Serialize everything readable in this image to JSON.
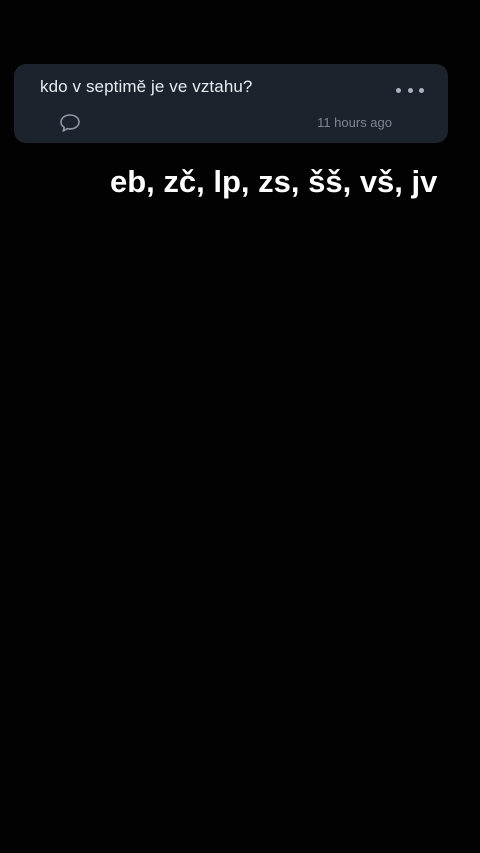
{
  "question_card": {
    "question": "kdo v septimě je ve vztahu?",
    "timestamp": "11 hours ago",
    "more_icon": "more-horizontal-icon",
    "comment_icon": "speech-bubble-icon"
  },
  "overlay": {
    "text": "eb, zč, lp, zs, šš, vš, jv"
  },
  "colors": {
    "background": "#020202",
    "card": "#1c232c",
    "card_text": "#e8ecf1",
    "muted": "#7d8794",
    "overlay_text": "#ffffff"
  }
}
